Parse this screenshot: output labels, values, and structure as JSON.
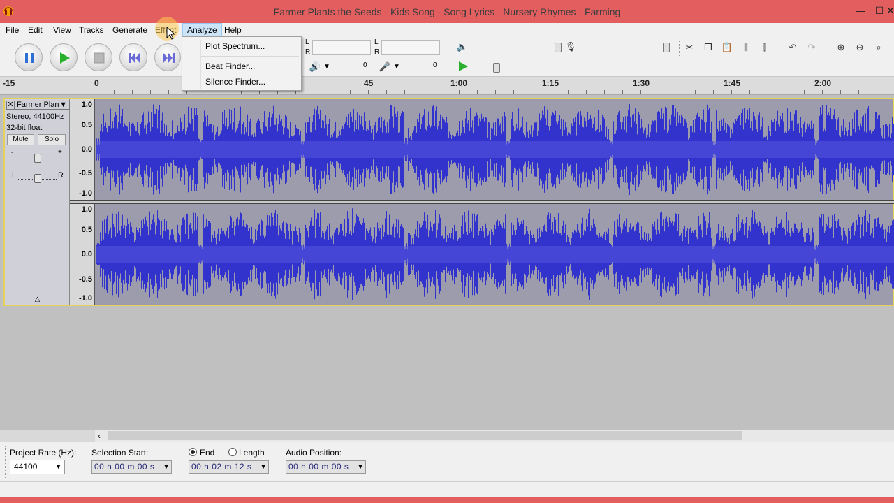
{
  "window": {
    "title": "Farmer Plants the Seeds - Kids Song - Song Lyrics - Nursery Rhymes - Farming",
    "minimize": "—",
    "maximize": "☐",
    "close": "✕"
  },
  "menubar": {
    "items": [
      "File",
      "Edit",
      "View",
      "Tracks",
      "Generate",
      "Effect",
      "Analyze",
      "Help"
    ]
  },
  "analyze_menu": {
    "items": [
      "Plot Spectrum...",
      "Beat Finder...",
      "Silence Finder..."
    ]
  },
  "meters": {
    "playback_L": "L",
    "playback_R": "R",
    "record_L": "L",
    "record_R": "R",
    "output_value": "0",
    "input_value": "0"
  },
  "ruler": {
    "labels": [
      "-15",
      "0",
      "45",
      "1:00",
      "1:15",
      "1:30",
      "1:45",
      "2:00"
    ]
  },
  "track": {
    "name": "Farmer Plan",
    "format": "Stereo, 44100Hz",
    "bits": "32-bit float",
    "mute": "Mute",
    "solo": "Solo",
    "pan_L": "L",
    "pan_R": "R",
    "gain_minus": "-",
    "gain_plus": "+",
    "scale_labels": [
      "1.0",
      "0.5",
      "0.0",
      "-0.5",
      "-1.0"
    ],
    "waveform_color": "#3232cc"
  },
  "bottom": {
    "project_rate_label": "Project Rate (Hz):",
    "project_rate_value": "44100",
    "selection_start_label": "Selection Start:",
    "end_label": "End",
    "length_label": "Length",
    "audio_position_label": "Audio Position:",
    "selection_start_value": "00 h 00 m 00 s",
    "end_value": "00 h 02 m 12 s",
    "audio_position_value": "00 h 00 m 00 s"
  },
  "colors": {
    "titlebar": "#e35f5f",
    "waveform": "#3232cc",
    "track_bg": "#9c9cac",
    "selection_border": "#e6d25a"
  }
}
